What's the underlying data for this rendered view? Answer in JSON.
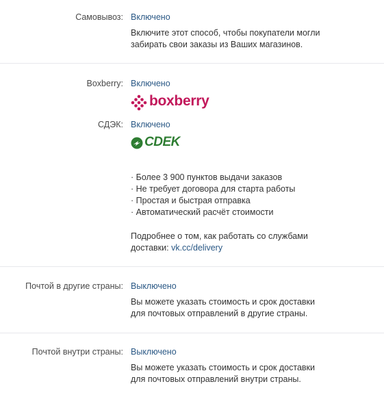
{
  "pickup": {
    "label": "Самовывоз:",
    "status": "Включено",
    "description": [
      "Включите этот способ, чтобы покупатели могли",
      "забирать свои заказы из Ваших магазинов."
    ]
  },
  "boxberry": {
    "label": "Boxberry:",
    "status": "Включено",
    "logo_text": "boxberry",
    "logo_icon": "boxberry-dots-icon",
    "brand_color": "#c2185b"
  },
  "cdek": {
    "label": "СДЭК:",
    "status": "Включено",
    "logo_text": "СDEK",
    "logo_icon": "cdek-circle-icon",
    "brand_color": "#2e7d32",
    "features": [
      "· Более 3 900 пунктов выдачи заказов",
      "· Не требует договора для старта работы",
      "· Простая и быстрая отправка",
      "· Автоматический расчёт стоимости"
    ],
    "more_info": "Подробнее о том, как работать со службами",
    "more_info_prefix": "доставки: ",
    "more_info_link": "vk.cc/delivery"
  },
  "intl_post": {
    "label": "Почтой в другие страны:",
    "status": "Выключено",
    "description": [
      "Вы можете указать стоимость и срок доставки",
      "для почтовых отправлений в другие страны."
    ]
  },
  "domestic_post": {
    "label": "Почтой внутри страны:",
    "status": "Выключено",
    "description": [
      "Вы можете указать стоимость и срок доставки",
      "для почтовых отправлений внутри страны."
    ]
  },
  "colors": {
    "link": "#2a5885",
    "label": "#4a4a4a",
    "divider": "#e7e8ec"
  }
}
